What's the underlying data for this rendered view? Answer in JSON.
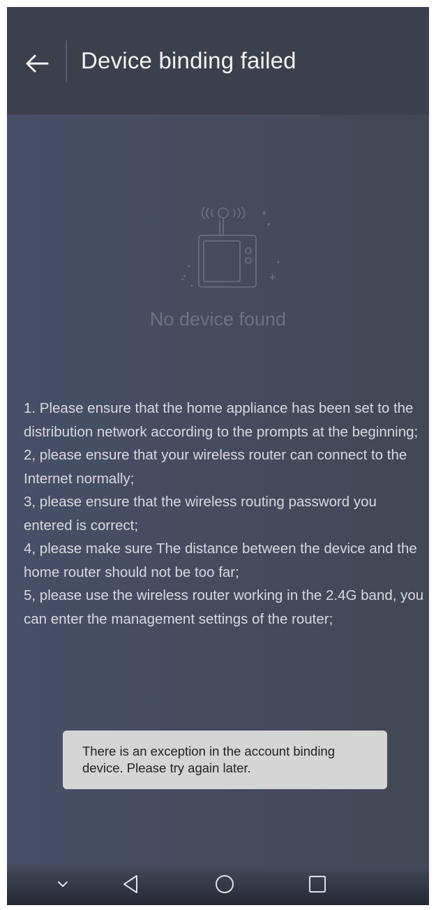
{
  "header": {
    "title": "Device binding failed",
    "back_icon": "arrow-left-icon"
  },
  "empty_state": {
    "icon": "tv-antenna-icon",
    "message": "No device found"
  },
  "tips": [
    "1. Please ensure that the home appliance has been set to the distribution network according to the prompts at the beginning;",
    "2, please ensure that your wireless router can connect to the Internet normally;",
    "3, please ensure that the wireless routing password you entered is correct;",
    "4, please make sure The distance between the device and the home router should not be too far;",
    "5, please use the wireless router working in the 2.4G band, you can enter the management settings of the router;"
  ],
  "toast": {
    "message": "There is an exception in the account binding device. Please try again later."
  },
  "navigation_bar": {
    "buttons": [
      "chevron-down-icon",
      "back-triangle-icon",
      "home-circle-icon",
      "recents-square-icon"
    ]
  },
  "colors": {
    "header_bg": "#3b404c",
    "content_bg": "#454c5e",
    "text_primary": "#f2f3f5",
    "text_muted": "#6b7180",
    "toast_bg": "#d5d5d5"
  }
}
